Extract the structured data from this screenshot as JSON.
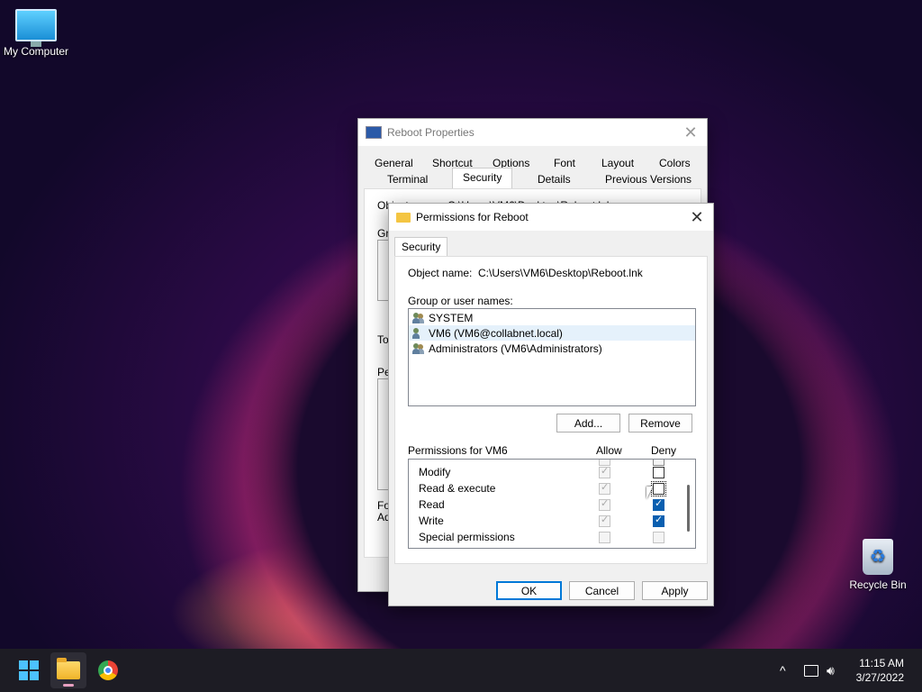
{
  "desktop": {
    "my_computer": "My Computer",
    "recycle_bin": "Recycle Bin"
  },
  "props_window": {
    "title": "Reboot Properties",
    "tabs_row1": [
      "General",
      "Shortcut",
      "Options",
      "Font",
      "Layout",
      "Colors"
    ],
    "tabs_row2": [
      "Terminal",
      "Security",
      "Details",
      "Previous Versions"
    ],
    "active_tab": "Security",
    "object_name_label": "Object name:",
    "object_name_value": "C:\\Users\\VM6\\Desktop\\Reboot.lnk",
    "fragments": {
      "group": "Gro",
      "to": "To",
      "pe": "Pe",
      "fo": "Fo",
      "ad": "Ad"
    }
  },
  "perm_dialog": {
    "title": "Permissions for Reboot",
    "tab": "Security",
    "object_name_label": "Object name:",
    "object_name_value": "C:\\Users\\VM6\\Desktop\\Reboot.lnk",
    "group_label": "Group or user names:",
    "users": [
      {
        "name": "SYSTEM",
        "icon": "group-icon",
        "selected": false
      },
      {
        "name": "VM6 (VM6@collabnet.local)",
        "icon": "user-icon",
        "selected": true
      },
      {
        "name": "Administrators (VM6\\Administrators)",
        "icon": "group-icon",
        "selected": false
      }
    ],
    "add_label": "Add...",
    "remove_label": "Remove",
    "perm_header": "Permissions for VM6",
    "allow_label": "Allow",
    "deny_label": "Deny",
    "permissions": [
      {
        "name": "Modify",
        "allow": "grey-checked",
        "deny": "unchecked"
      },
      {
        "name": "Read & execute",
        "allow": "grey-checked",
        "deny": "unchecked"
      },
      {
        "name": "Read",
        "allow": "grey-checked",
        "deny": "checked"
      },
      {
        "name": "Write",
        "allow": "grey-checked",
        "deny": "checked"
      },
      {
        "name": "Special permissions",
        "allow": "disabled",
        "deny": "disabled"
      }
    ],
    "ok_label": "OK",
    "cancel_label": "Cancel",
    "apply_label": "Apply"
  },
  "taskbar": {
    "time": "11:15 AM",
    "date": "3/27/2022",
    "tray_chevron": "^"
  },
  "colors": {
    "accent": "#0078d7",
    "checked": "#0a5fb0",
    "taskbar": "#1d1c24"
  }
}
